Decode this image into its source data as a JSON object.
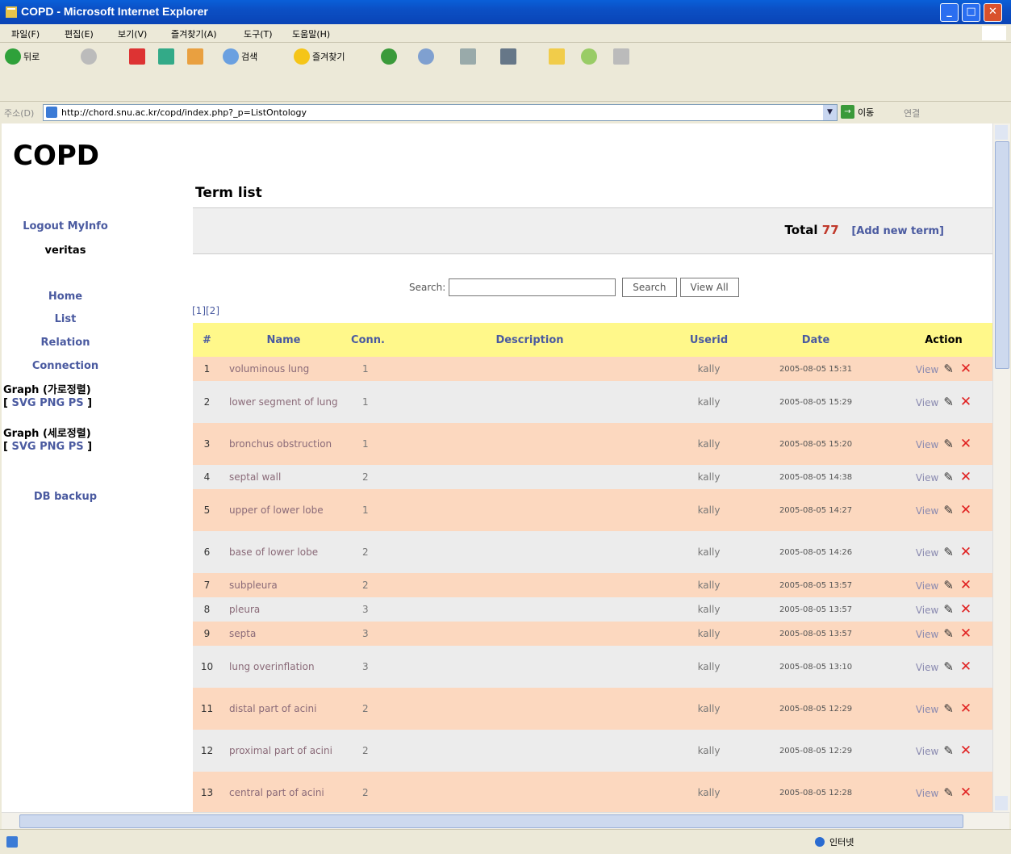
{
  "window": {
    "title": "COPD - Microsoft Internet Explorer",
    "minimize": "_",
    "maximize": "□",
    "close": "✕"
  },
  "menu": [
    "파일(F)",
    "편집(E)",
    "보기(V)",
    "즐겨찾기(A)",
    "도구(T)",
    "도움말(H)"
  ],
  "toolbar": {
    "back": "뒤로",
    "search": "검색",
    "favorites": "즐겨찾기"
  },
  "address": {
    "label": "주소(D)",
    "url": "http://chord.snu.ac.kr/copd/index.php?_p=ListOntology",
    "go": "이동",
    "links": "연결"
  },
  "page": {
    "logo": "COPD",
    "sidebar": {
      "logout": "Logout",
      "myinfo": "MyInfo",
      "user": "veritas",
      "home": "Home",
      "list": "List",
      "relation": "Relation",
      "connection": "Connection",
      "graph_h": "Graph (가로정렬)",
      "graph_v": "Graph (세로정렬)",
      "fmt_open": "[",
      "svg": "SVG",
      "png": "PNG",
      "ps": "PS",
      "fmt_close": "]",
      "backup": "DB backup"
    },
    "title": "Term list",
    "total_label": "Total",
    "total_value": "77",
    "add_term": "[Add new term]",
    "search_label": "Search:",
    "search_value": "",
    "search_button": "Search",
    "viewall_button": "View All",
    "pages": [
      "[1]",
      "[2]"
    ],
    "columns": [
      "#",
      "Name",
      "Conn.",
      "Description",
      "Userid",
      "Date",
      "Action"
    ],
    "action_view": "View",
    "rows": [
      {
        "no": "1",
        "name": "voluminous lung",
        "conn": "1",
        "desc": "",
        "user": "kally",
        "date": "2005-08-05 15:31"
      },
      {
        "no": "2",
        "name": "lower segment of lung",
        "conn": "1",
        "desc": "",
        "user": "kally",
        "date": "2005-08-05 15:29"
      },
      {
        "no": "3",
        "name": "bronchus obstruction",
        "conn": "1",
        "desc": "",
        "user": "kally",
        "date": "2005-08-05 15:20"
      },
      {
        "no": "4",
        "name": "septal wall",
        "conn": "2",
        "desc": "",
        "user": "kally",
        "date": "2005-08-05 14:38"
      },
      {
        "no": "5",
        "name": "upper of lower lobe",
        "conn": "1",
        "desc": "",
        "user": "kally",
        "date": "2005-08-05 14:27"
      },
      {
        "no": "6",
        "name": "base of lower lobe",
        "conn": "2",
        "desc": "",
        "user": "kally",
        "date": "2005-08-05 14:26"
      },
      {
        "no": "7",
        "name": "subpleura",
        "conn": "2",
        "desc": "",
        "user": "kally",
        "date": "2005-08-05 13:57"
      },
      {
        "no": "8",
        "name": "pleura",
        "conn": "3",
        "desc": "",
        "user": "kally",
        "date": "2005-08-05 13:57"
      },
      {
        "no": "9",
        "name": "septa",
        "conn": "3",
        "desc": "",
        "user": "kally",
        "date": "2005-08-05 13:57"
      },
      {
        "no": "10",
        "name": "lung overinflation",
        "conn": "3",
        "desc": "",
        "user": "kally",
        "date": "2005-08-05 13:10"
      },
      {
        "no": "11",
        "name": "distal part of acini",
        "conn": "2",
        "desc": "",
        "user": "kally",
        "date": "2005-08-05 12:29"
      },
      {
        "no": "12",
        "name": "proximal part of acini",
        "conn": "2",
        "desc": "",
        "user": "kally",
        "date": "2005-08-05 12:29"
      },
      {
        "no": "13",
        "name": "central part of acini",
        "conn": "2",
        "desc": "",
        "user": "kally",
        "date": "2005-08-05 12:28"
      }
    ]
  },
  "status": {
    "zone": "인터넷"
  },
  "colors": {
    "header": "#fff88a",
    "row_odd": "#fcd8bf",
    "row_even": "#ececec",
    "link": "#4a5aa0",
    "total": "#c0392b"
  }
}
